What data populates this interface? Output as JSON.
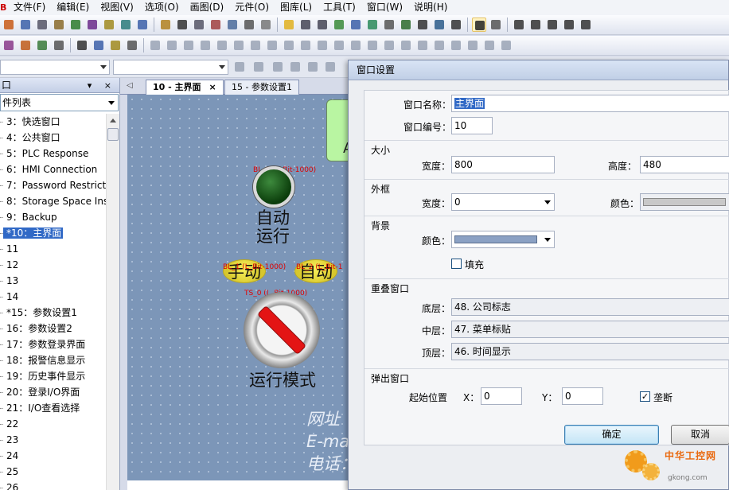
{
  "menu": {
    "logo": "B",
    "items": [
      "文件(F)",
      "编辑(E)",
      "视图(V)",
      "选项(O)",
      "画图(D)",
      "元件(O)",
      "图库(L)",
      "工具(T)",
      "窗口(W)",
      "说明(H)"
    ]
  },
  "left_panel": {
    "title": "口",
    "controls": "▾ ×",
    "combo_value": "件列表",
    "items": [
      {
        "label": "3：快选窗口",
        "selected": false
      },
      {
        "label": "4：公共窗口",
        "selected": false
      },
      {
        "label": "5：PLC Response",
        "selected": false
      },
      {
        "label": "6：HMI Connection",
        "selected": false
      },
      {
        "label": "7：Password Restrict",
        "selected": false
      },
      {
        "label": "8：Storage Space Ins",
        "selected": false
      },
      {
        "label": "9：Backup",
        "selected": false
      },
      {
        "label": "*10：主界面",
        "selected": true
      },
      {
        "label": "11",
        "selected": false
      },
      {
        "label": "12",
        "selected": false
      },
      {
        "label": "13",
        "selected": false
      },
      {
        "label": "14",
        "selected": false
      },
      {
        "label": "*15：参数设置1",
        "selected": false
      },
      {
        "label": "16：参数设置2",
        "selected": false
      },
      {
        "label": "17：参数登录界面",
        "selected": false
      },
      {
        "label": "18：报警信息显示",
        "selected": false
      },
      {
        "label": "19：历史事件显示",
        "selected": false
      },
      {
        "label": "20：登录I/O界面",
        "selected": false
      },
      {
        "label": "21：I/O查看选择",
        "selected": false
      },
      {
        "label": "22",
        "selected": false
      },
      {
        "label": "23",
        "selected": false
      },
      {
        "label": "24",
        "selected": false
      },
      {
        "label": "25",
        "selected": false
      },
      {
        "label": "26",
        "selected": false
      }
    ]
  },
  "tabs": {
    "nav": "◁",
    "items": [
      {
        "label": "10 - 主界面",
        "close": "×",
        "active": true
      },
      {
        "label": "15 - 参数设置1",
        "close": "",
        "active": false
      }
    ]
  },
  "canvas": {
    "green_box_text": "A",
    "lamp_tag": "BL_0 (L_Bit-1000)",
    "lamp_label_1": "自动",
    "lamp_label_2": "运行",
    "btn_tag_1": "BL_1 (L_Bit-1000)",
    "btn_tag_2": "BL_2 (L_Bit-1",
    "btn_manual": "手动",
    "btn_auto": "自动",
    "switch_tag": "TS_0 (L_Bit-1000)",
    "switch_label": "运行模式",
    "info_1": "网址",
    "info_2": "E-ma",
    "info_3": "电话："
  },
  "dialog": {
    "title": "窗口设置",
    "name_label": "窗口名称：",
    "name_value": "主界面",
    "number_label": "窗口编号：",
    "number_value": "10",
    "size_group": "大小",
    "width_label": "宽度：",
    "width_value": "800",
    "height_label": "高度：",
    "height_value": "480",
    "frame_group": "外框",
    "frame_width_label": "宽度：",
    "frame_width_value": "0",
    "frame_color_label": "颜色：",
    "bg_group": "背景",
    "bg_color_label": "颜色：",
    "fill_label": "填充",
    "fill_checked": false,
    "overlap_group": "重叠窗口",
    "bottom_label": "底层：",
    "bottom_value": "48. 公司标志",
    "middle_label": "中层：",
    "middle_value": "47. 菜单标贴",
    "top_label": "顶层：",
    "top_value": "46. 时间显示",
    "popup_group": "弹出窗口",
    "start_pos_label": "起始位置",
    "x_label": "X：",
    "x_value": "0",
    "y_label": "Y：",
    "y_value": "0",
    "exclusive_label": "垄断",
    "exclusive_checked": true,
    "check_mark": "✓",
    "ok_button": "确定",
    "cancel_button": "取消"
  },
  "watermark": {
    "title": "中华工控网",
    "url": "gkong.com"
  },
  "colors": {
    "canvas_bg": "#7c96b8",
    "selection": "#3169c6",
    "tag_red": "#e00000",
    "lamp_green": "#0b3d0b",
    "button_yellow": "#f7ef5a",
    "switch_red": "#e31414",
    "bg_color_swatch": "#8ba1c4"
  }
}
